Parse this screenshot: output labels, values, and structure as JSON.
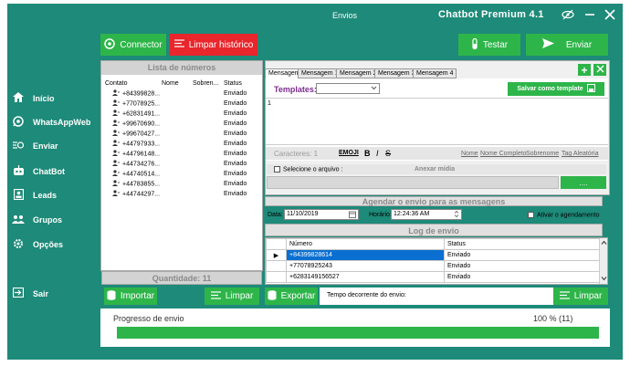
{
  "window": {
    "title": "Envios",
    "brand": "Chatbot   Premium 4.1"
  },
  "sidebar": {
    "items": [
      {
        "label": "Início",
        "icon": "home-icon"
      },
      {
        "label": "WhatsAppWeb",
        "icon": "whatsapp-icon"
      },
      {
        "label": "Enviar",
        "icon": "send-icon"
      },
      {
        "label": "ChatBot",
        "icon": "robot-icon"
      },
      {
        "label": "Leads",
        "icon": "contacts-icon"
      },
      {
        "label": "Grupos",
        "icon": "group-icon"
      },
      {
        "label": "Opções",
        "icon": "gear-icon"
      },
      {
        "label": "Sair",
        "icon": "exit-icon"
      }
    ]
  },
  "toolbar": {
    "connect_label": "Connector",
    "clear_label": "Limpar histórico",
    "test_label": "Testar",
    "send_label": "Enviar"
  },
  "numbers": {
    "header": "Lista de números",
    "columns": [
      "Contato",
      "Nome",
      "Sobren...",
      "Status"
    ],
    "rows": [
      {
        "contact": "+84399828...",
        "status": "Enviado"
      },
      {
        "contact": "+77078925...",
        "status": "Enviado"
      },
      {
        "contact": "+62831491...",
        "status": "Enviado"
      },
      {
        "contact": "+99670690...",
        "status": "Enviado"
      },
      {
        "contact": "+99670427...",
        "status": "Enviado"
      },
      {
        "contact": "+44797933...",
        "status": "Enviado"
      },
      {
        "contact": "+44796148...",
        "status": "Enviado"
      },
      {
        "contact": "+44734276...",
        "status": "Enviado"
      },
      {
        "contact": "+44740514...",
        "status": "Enviado"
      },
      {
        "contact": "+44783855...",
        "status": "Enviado"
      },
      {
        "contact": "+44744297...",
        "status": "Enviado"
      }
    ],
    "quantity_label": "Quantidade: 11",
    "import_label": "Importar",
    "clear_label": "Limpar"
  },
  "message": {
    "tabs": [
      "Mensagem",
      "Mensagem 1",
      "Mensagem 2",
      "Mensagem 3",
      "Mensagem 4"
    ],
    "templates_label": "Templates:",
    "save_template_label": "Salvar como template",
    "text": "1",
    "chars_label": "Caracteres: 1",
    "emoji_label": "EMOJI",
    "bold_label": "B",
    "italic_label": "I",
    "strike_label": "S",
    "links": [
      "Nome",
      "Nome Completo",
      "Sobrenome",
      "Tag Aleatória"
    ],
    "select_file_label": "Selecione o arquivo :",
    "attach_label": "Anexar mídia",
    "browse_label": "...."
  },
  "schedule": {
    "header": "Agendar o envio para as mensagens",
    "date_label": "Data:",
    "date_value": "11/10/2019",
    "time_label": "Horário:",
    "time_value": "12:24:36 AM",
    "activate_label": "Ativar o agendamento"
  },
  "log": {
    "header": "Log de envio",
    "columns": [
      "Número",
      "Status"
    ],
    "rows": [
      {
        "number": "+84399828614",
        "status": "Enviado"
      },
      {
        "number": "+77078925243",
        "status": "Enviado"
      },
      {
        "number": "+6283149156527",
        "status": "Enviado"
      }
    ],
    "export_label": "Exportar",
    "elapsed_label": "Tempo decorrente do envio:",
    "clear_label": "Limpar"
  },
  "progress": {
    "label": "Progresso de envio",
    "value_label": "100 % (11)",
    "fraction": 1.0
  },
  "colors": {
    "teal": "#1e8a79",
    "green": "#2eb54a",
    "red": "#e8262b",
    "selected": "#0a6fd1"
  }
}
